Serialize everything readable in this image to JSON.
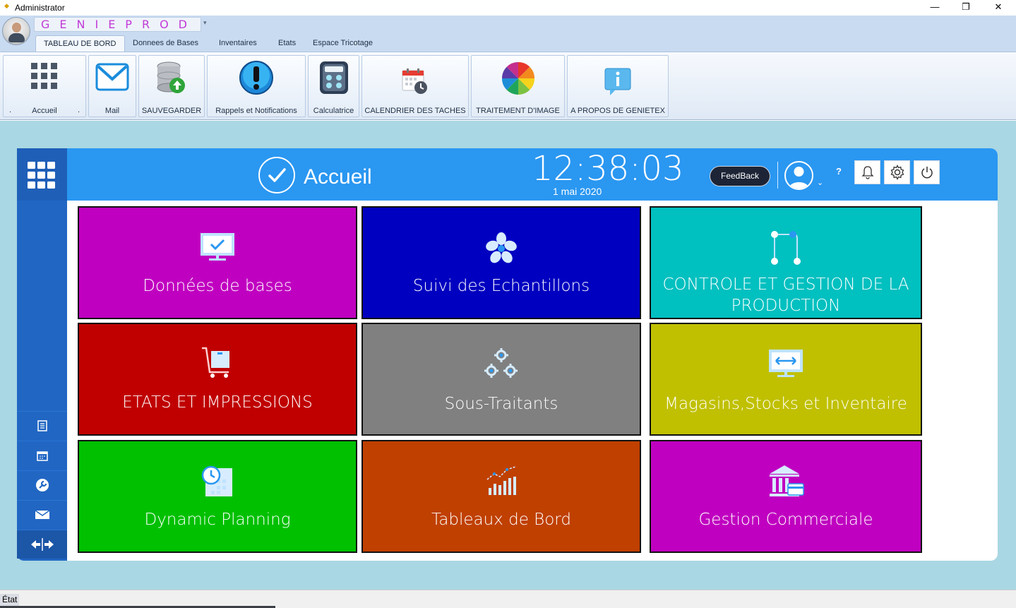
{
  "window": {
    "title": "Administrator",
    "controls": {
      "minimize": "—",
      "restore": "❐",
      "close": "✕"
    }
  },
  "app": {
    "name": "GENIEPROD"
  },
  "ribbon": {
    "tabs": [
      {
        "label": "TABLEAU DE BORD",
        "active": true
      },
      {
        "label": "Donnees de Bases"
      },
      {
        "label": "Inventaires"
      },
      {
        "label": "Etats"
      },
      {
        "label": "Espace Tricotage"
      }
    ],
    "buttons": [
      {
        "label": "Accueil",
        "icon": "grid-icon"
      },
      {
        "label": "Mail",
        "icon": "mail-icon"
      },
      {
        "label": "SAUVEGARDER",
        "icon": "database-save-icon"
      },
      {
        "label": "Rappels et Notifications",
        "icon": "alert-icon"
      },
      {
        "label": "Calculatrice",
        "icon": "calculator-icon"
      },
      {
        "label": "CALENDRIER DES TACHES",
        "icon": "calendar-clock-icon"
      },
      {
        "label": "TRAITEMENT D'IMAGE",
        "icon": "color-wheel-icon"
      },
      {
        "label": "A PROPOS DE GENIETEX",
        "icon": "info-bubble-icon"
      }
    ],
    "accueil_dot": "."
  },
  "header": {
    "title": "Accueil",
    "clock": "12:38:03",
    "date": "1 mai 2020",
    "feedback_label": "FeedBack",
    "help_label": "?",
    "caret": "⌄"
  },
  "tiles": [
    {
      "label": "Données de bases",
      "color": "#c000c0",
      "icon": "monitor-check-icon"
    },
    {
      "label": "Suivi des Echantillons",
      "color": "#0000c0",
      "icon": "flower-icon"
    },
    {
      "label": "CONTROLE ET GESTION DE LA PRODUCTION",
      "color": "#00c0c0",
      "icon": "flow-nodes-icon"
    },
    {
      "label": "ETATS ET IMPRESSIONS",
      "color": "#c00000",
      "icon": "cart-icon"
    },
    {
      "label": "Sous-Traitants",
      "color": "#808080",
      "icon": "gears-icon"
    },
    {
      "label": "Magasins,Stocks et Inventaire",
      "color": "#c0c000",
      "icon": "monitor-arrows-icon"
    },
    {
      "label": "Dynamic Planning",
      "color": "#00c000",
      "icon": "clock-calendar-icon"
    },
    {
      "label": "Tableaux de Bord",
      "color": "#c04000",
      "icon": "bar-chart-icon"
    },
    {
      "label": "Gestion Commerciale",
      "color": "#c000c0",
      "icon": "bank-icon"
    }
  ],
  "statusbar": {
    "label": "État"
  },
  "colors": {
    "workspace": "#a9d7e3",
    "sidebar": "#2166c3",
    "header": "#2a97f1"
  }
}
